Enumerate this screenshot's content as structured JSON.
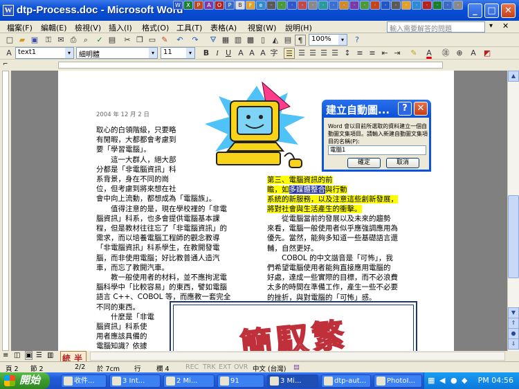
{
  "window": {
    "title": "dtp-Process.doc - Microsoft Word",
    "app_icon": "W"
  },
  "menubar": {
    "items": [
      "檔案(F)",
      "編輯(E)",
      "檢視(V)",
      "插入(I)",
      "格式(O)",
      "工具(T)",
      "表格(A)",
      "視窗(W)",
      "說明(H)"
    ],
    "help_placeholder": "輸入需要解答的問題"
  },
  "toolbar": {
    "zoom": "100%",
    "style": "text1",
    "font": "細明體",
    "size": "11",
    "bold": "B",
    "italic": "I",
    "underline": "U",
    "fontcolor": "A"
  },
  "document": {
    "date": "2004 年 12 月 2 日",
    "left_column": "取心的白領階級，只要略\n有閒暇，大都都會考慮到\n要「學習電腦」。\n　　這一大群人，絕大部\n分都是「非電腦資訊」科\n系背景，身在不同的崗\n位，但考慮到將來想在社\n會中向上流動，都想成為「電腦族」。\n　　值得注意的是，現在學校裡的「非電\n腦資訊」科系，也多會提供電腦基本課\n程，但是教材往往忘了「非電腦資訊」的\n需求，而以培養電腦工程師的觀念教導\n「非電腦資訊」科系學生，在教開發電\n腦，而非使用電腦；好比教普通人造汽\n車，而忘了教開汽車。\n　　教一般使用者的材料，並不應拘泥電\n腦科學中「比較容易」的東西，譬如電腦\n語言 C++、COBOL 等，而應教一套完全\n不同的東西。\n　　什麼是「非電\n腦資訊」科系使\n用者應該具備的\n電腦知識？依據",
    "right_top_1": "第三、電腦資訊的前",
    "right_top_2a": "瞻，如",
    "right_top_2b": "多媒體整合",
    "right_top_2c": "與行動",
    "right_top_3": "系統的新服務，以及注意這些創新發展，",
    "right_top_4": "將對社會與生活產生的衝擊。",
    "right_column": "　　從電腦當前的發展以及未來的趨勢\n來看，電腦一般使用者似乎應強調應用為\n優先。當然，能夠多知道一些基礎語言還\n輔，自然更好。\n　　COBOL 的中文諧音是「可怖」，我\n們希望電腦使用者能夠直接應用電腦的\n好處，達成一些實際的目標，而不必浪費\n太多的時間在準備工作，產生一些不必要\n的挫折，與對電腦的「可怖」感。",
    "wordart": "簡馭繁"
  },
  "dialog": {
    "title": "建立自動圖...",
    "help": "?",
    "close": "✕",
    "message": "Word 會以目前所選取的資料建立一個自動圖文集項目。請輸入新建自動圖文集項目的名稱(P):",
    "field_value": "電腦1",
    "ok": "確定",
    "cancel": "取消"
  },
  "ime": {
    "a": "統",
    "b": "半"
  },
  "status": {
    "page": "頁 2",
    "section": "節 2",
    "pages": "2/2",
    "at": "於 7cm",
    "line": "行",
    "col": "欄 4",
    "rec": "REC",
    "trk": "TRK",
    "ext": "EXT",
    "ovr": "OVR",
    "lang": "中文 (台灣)"
  },
  "taskbar": {
    "start": "開始",
    "tasks": [
      "收件...",
      "3 Int...",
      "2 Mi...",
      "91",
      "3 Mi...",
      "dtp-aut...",
      "PhotoI..."
    ],
    "clock": "PM 04:56"
  }
}
